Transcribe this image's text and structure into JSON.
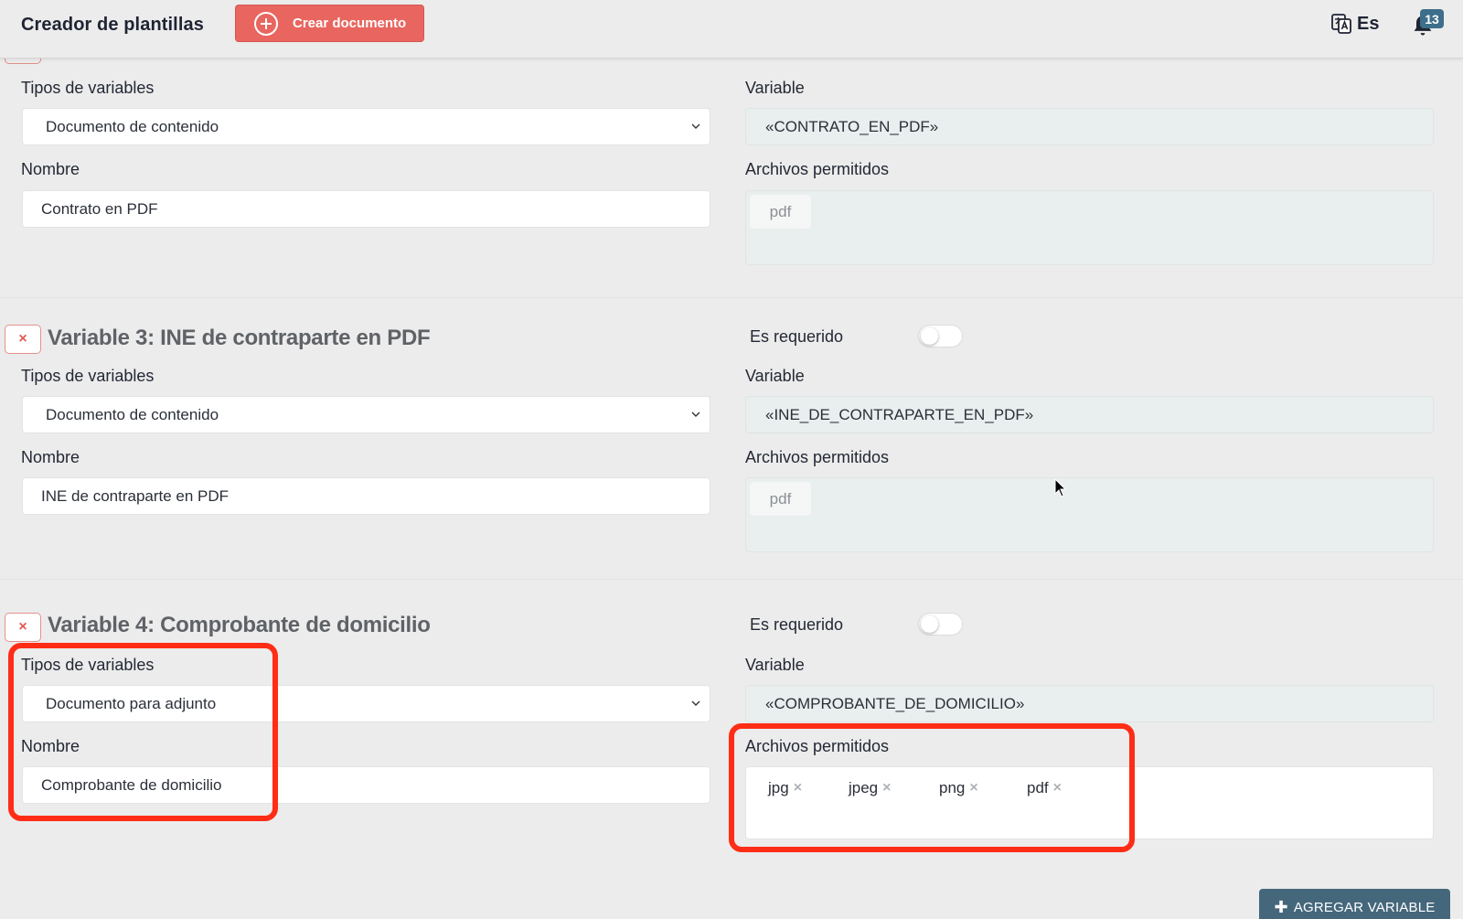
{
  "header": {
    "title": "Creador de plantillas",
    "create_button": "Crear documento",
    "language": "Es",
    "notification_count": "13"
  },
  "labels": {
    "variable_types": "Tipos de variables",
    "name": "Nombre",
    "variable": "Variable",
    "allowed_files": "Archivos permitidos",
    "required": "Es requerido",
    "remove_symbol": "×"
  },
  "variables": [
    {
      "type": "Documento de contenido",
      "name": "Contrato en PDF",
      "variable": "«CONTRATO_EN_PDF»",
      "allowed_files": [
        "pdf"
      ]
    },
    {
      "title": "Variable 3: INE de contraparte en PDF",
      "type": "Documento de contenido",
      "name": "INE de contraparte en PDF",
      "variable": "«INE_DE_CONTRAPARTE_EN_PDF»",
      "allowed_files": [
        "pdf"
      ],
      "required": false
    },
    {
      "title": "Variable 4: Comprobante de domicilio",
      "type": "Documento para adjunto",
      "name": "Comprobante de domicilio",
      "variable": "«COMPROBANTE_DE_DOMICILIO»",
      "allowed_files": [
        "jpg",
        "jpeg",
        "png",
        "pdf"
      ],
      "required": false
    }
  ],
  "add_variable_button": "AGREGAR VARIABLE",
  "colors": {
    "accent_button": "#e8665f",
    "primary_button": "#45677c",
    "highlight": "#ff2d16"
  }
}
